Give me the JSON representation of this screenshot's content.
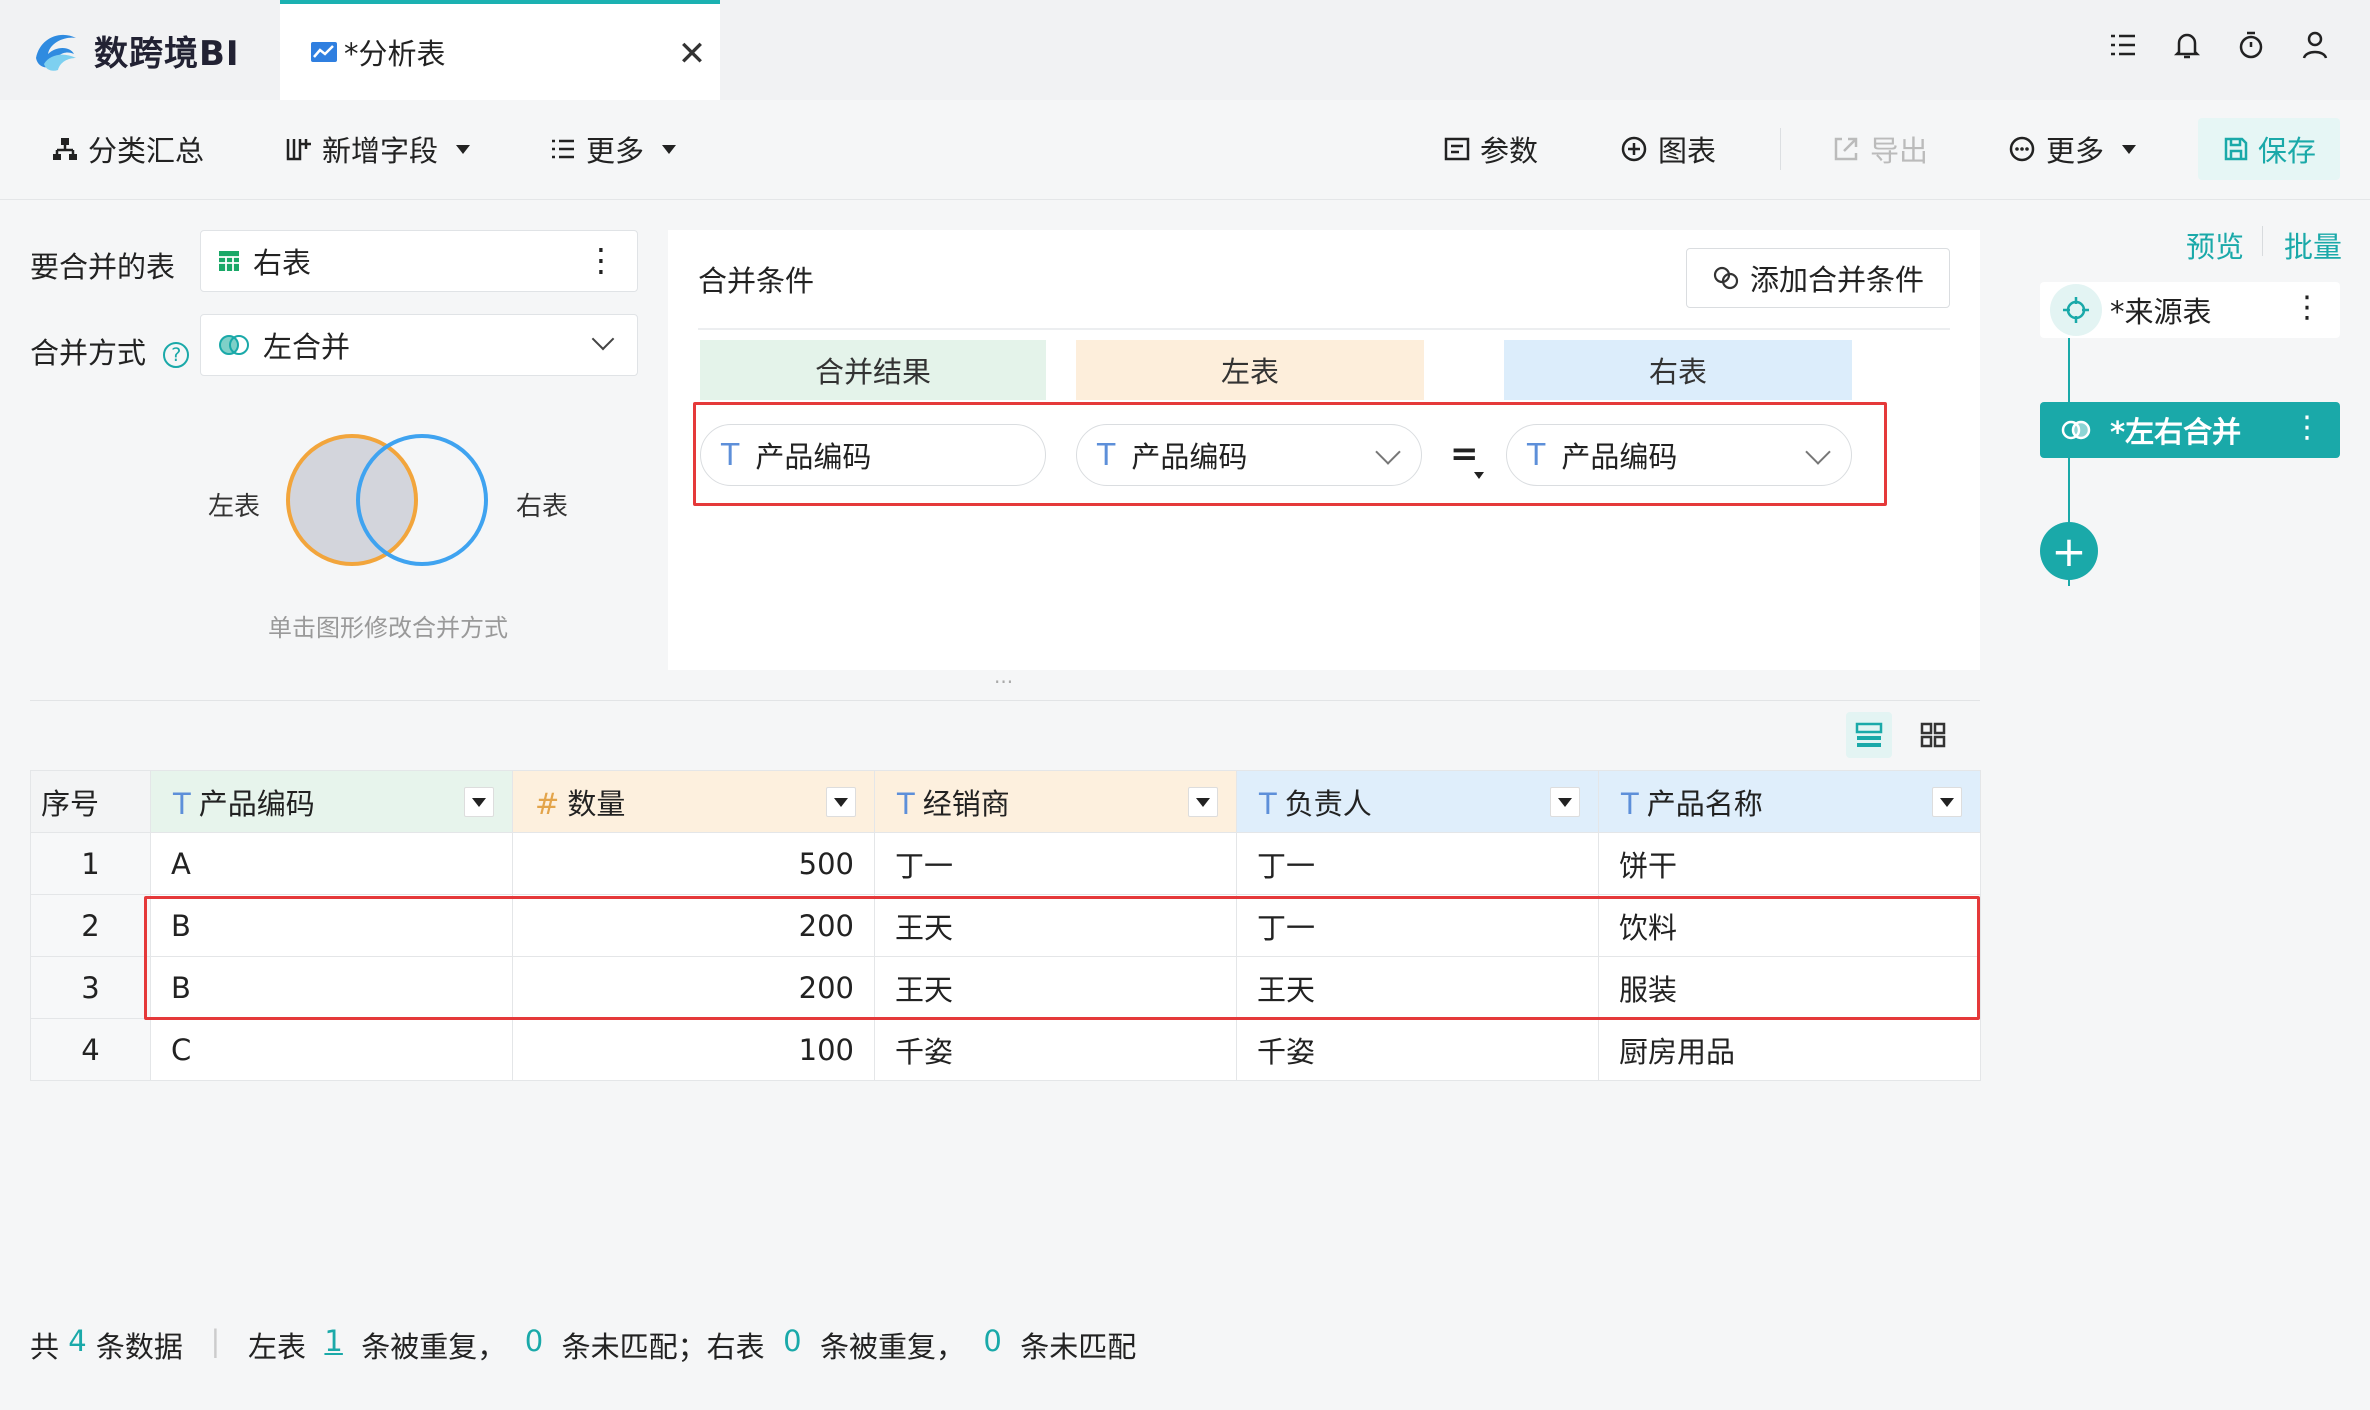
{
  "app": {
    "name": "数跨境BI"
  },
  "tab": {
    "label": "*分析表",
    "close": "✕"
  },
  "toolbar": {
    "group_summary": "分类汇总",
    "add_field": "新增字段",
    "more_left": "更多",
    "params": "参数",
    "chart": "图表",
    "export": "导出",
    "more_right": "更多",
    "save": "保存"
  },
  "merge_config": {
    "table_label": "要合并的表",
    "table_value": "右表",
    "method_label": "合并方式",
    "method_help": "?",
    "method_value": "左合并",
    "venn_left": "左表",
    "venn_right": "右表",
    "venn_hint": "单击图形修改合并方式"
  },
  "conditions": {
    "title": "合并条件",
    "add_button": "添加合并条件",
    "headers": {
      "result": "合并结果",
      "left": "左表",
      "right": "右表"
    },
    "row": {
      "type": "T",
      "result": "产品编码",
      "left": "产品编码",
      "op": "=",
      "right": "产品编码"
    }
  },
  "divider_handle": "···",
  "right_panel": {
    "preview": "预览",
    "batch": "批量",
    "nodes": [
      {
        "label": "*来源表",
        "more": "⋮"
      },
      {
        "label": "*左右合并",
        "more": "⋮"
      }
    ],
    "add": "+"
  },
  "table": {
    "index_header": "序号",
    "columns": [
      {
        "type": "T",
        "name": "产品编码",
        "header_color": "#e7f4ec"
      },
      {
        "type": "#",
        "name": "数量",
        "header_color": "#fdf0de"
      },
      {
        "type": "T",
        "name": "经销商",
        "header_color": "#fdf0de"
      },
      {
        "type": "T",
        "name": "负责人",
        "header_color": "#dfeefb"
      },
      {
        "type": "T",
        "name": "产品名称",
        "header_color": "#dfeefb"
      }
    ],
    "rows": [
      {
        "idx": "1",
        "code": "A",
        "qty": "500",
        "dealer": "丁一",
        "owner": "丁一",
        "product": "饼干"
      },
      {
        "idx": "2",
        "code": "B",
        "qty": "200",
        "dealer": "王天",
        "owner": "丁一",
        "product": "饮料"
      },
      {
        "idx": "3",
        "code": "B",
        "qty": "200",
        "dealer": "王天",
        "owner": "王天",
        "product": "服装"
      },
      {
        "idx": "4",
        "code": "C",
        "qty": "100",
        "dealer": "千姿",
        "owner": "千姿",
        "product": "厨房用品"
      }
    ]
  },
  "status": {
    "p1": "共 ",
    "total": "4",
    "p2": " 条数据",
    "bar": "   |   ",
    "p3": "左表  ",
    "left_dup": "1",
    "p4": "  条被重复，  ",
    "left_unmatched": "0",
    "p5": "  条未匹配；右表  ",
    "right_dup": "0",
    "p6": "  条被重复，  ",
    "right_unmatched": "0",
    "p7": "  条未匹配"
  },
  "colors": {
    "accent": "#1aa9a9",
    "highlight_red": "#e5393a",
    "venn_left": "#f2a53c",
    "venn_right": "#3fa3f0"
  }
}
